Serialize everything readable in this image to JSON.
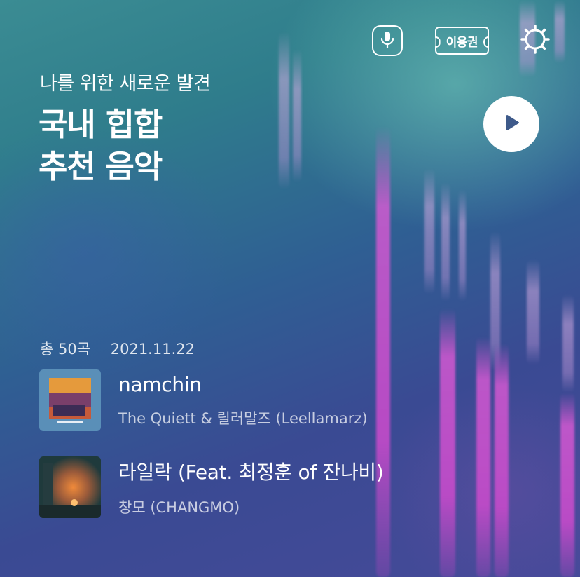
{
  "header": {
    "voice_search_icon": "mic-icon",
    "ticket_label": "이용권",
    "settings_icon": "gear-icon"
  },
  "hero": {
    "subtitle": "나를 위한 새로운 발견",
    "title_line1": "국내 힙합",
    "title_line2": "추천 음악",
    "play_icon": "play-icon"
  },
  "meta": {
    "count": "총 50곡",
    "date": "2021.11.22"
  },
  "tracks": [
    {
      "title": "namchin",
      "artist": "The Quiett & 릴러말즈 (Leellamarz)"
    },
    {
      "title": "라일락 (Feat. 최정훈 of 잔나비)",
      "artist": "창모 (CHANGMO)"
    }
  ],
  "colors": {
    "background_top": "#3b8c93",
    "background_bottom": "#464a99",
    "streak": "#e05ad8",
    "play_button": "#ffffff",
    "play_triangle": "#3e5a8a"
  }
}
